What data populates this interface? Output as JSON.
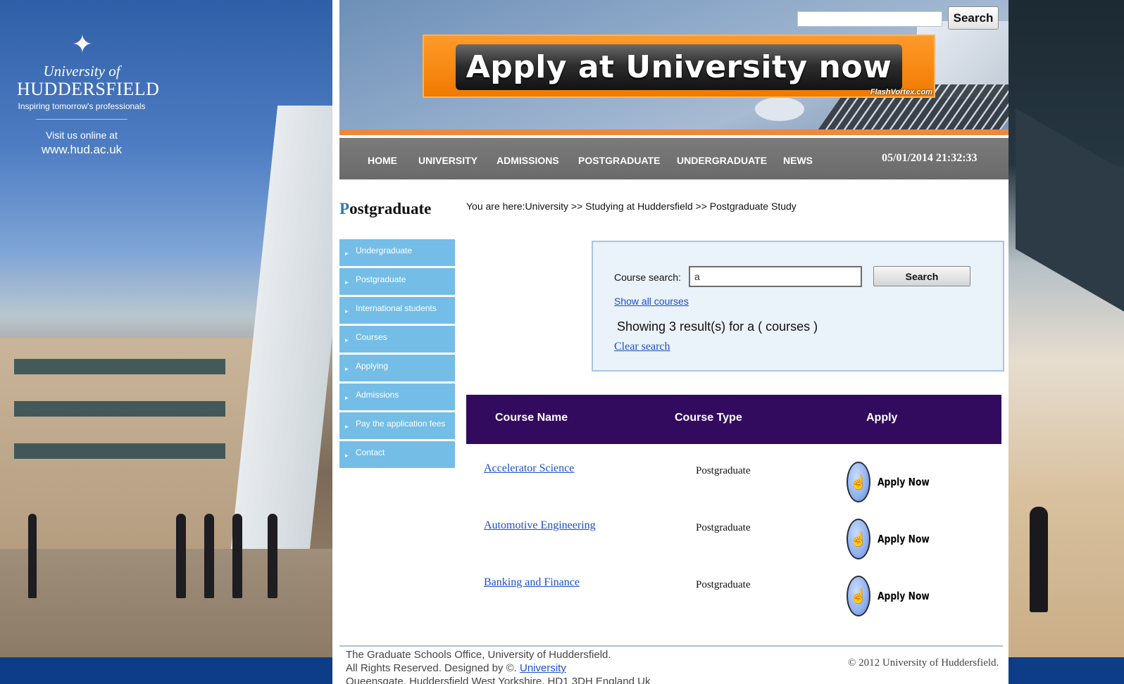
{
  "brand": {
    "university_line1": "University of",
    "university_line2": "HUDDERSFIELD",
    "tagline": "Inspiring tomorrow's professionals",
    "visit_text": "Visit us online at",
    "website": "www.hud.ac.uk"
  },
  "header": {
    "search_button": "Search",
    "search_value": "",
    "banner_text": "Apply at University now",
    "banner_credit": "FlashVortex.com"
  },
  "nav": {
    "items": [
      {
        "label": "HOME"
      },
      {
        "label": "UNIVERSITY"
      },
      {
        "label": "ADMISSIONS"
      },
      {
        "label": "POSTGRADUATE"
      },
      {
        "label": "UNDERGRADUATE"
      },
      {
        "label": "NEWS"
      }
    ],
    "datetime": "05/01/2014 21:32:33"
  },
  "sidebar": {
    "title_first": "P",
    "title_rest": "ostgraduate",
    "arrow": "▸",
    "items": [
      {
        "label": "Undergraduate"
      },
      {
        "label": "Postgraduate"
      },
      {
        "label": "International students"
      },
      {
        "label": "Courses"
      },
      {
        "label": "Applying"
      },
      {
        "label": "Admissions"
      },
      {
        "label": "Pay the application fees"
      },
      {
        "label": "Contact"
      }
    ]
  },
  "breadcrumb": "You are here:University >> Studying at Huddersfield >> Postgraduate Study",
  "course_search": {
    "label": "Course search:",
    "value": "a",
    "button": "Search",
    "show_all": "Show all courses",
    "results_text": "Showing 3 result(s) for a ( courses )",
    "clear": "Clear search"
  },
  "table": {
    "headers": [
      "Course Name",
      "Course Type",
      "Apply"
    ],
    "rows": [
      {
        "name": "Accelerator Science",
        "type": "Postgraduate",
        "apply": "Apply Now"
      },
      {
        "name": "Automotive Engineering",
        "type": "Postgraduate",
        "apply": "Apply Now"
      },
      {
        "name": "Banking and Finance",
        "type": "Postgraduate",
        "apply": "Apply Now"
      }
    ]
  },
  "footer": {
    "line1": "The Graduate Schools Office, University of Huddersfield.",
    "line2_prefix": "All Rights Reserved. Designed by ©.",
    "line2_link": "University",
    "line3": "Queensgate, Huddersfield West Yorkshire, HD1 3DH England Uk",
    "copyright": "© 2012 University of Huddersfield."
  },
  "colors": {
    "accent_blue": "#74bde6",
    "table_header": "#320b5e",
    "nav_gray": "#6a6a6a",
    "banner_orange": "#f07a00",
    "footer_band": "#0d3d86"
  }
}
